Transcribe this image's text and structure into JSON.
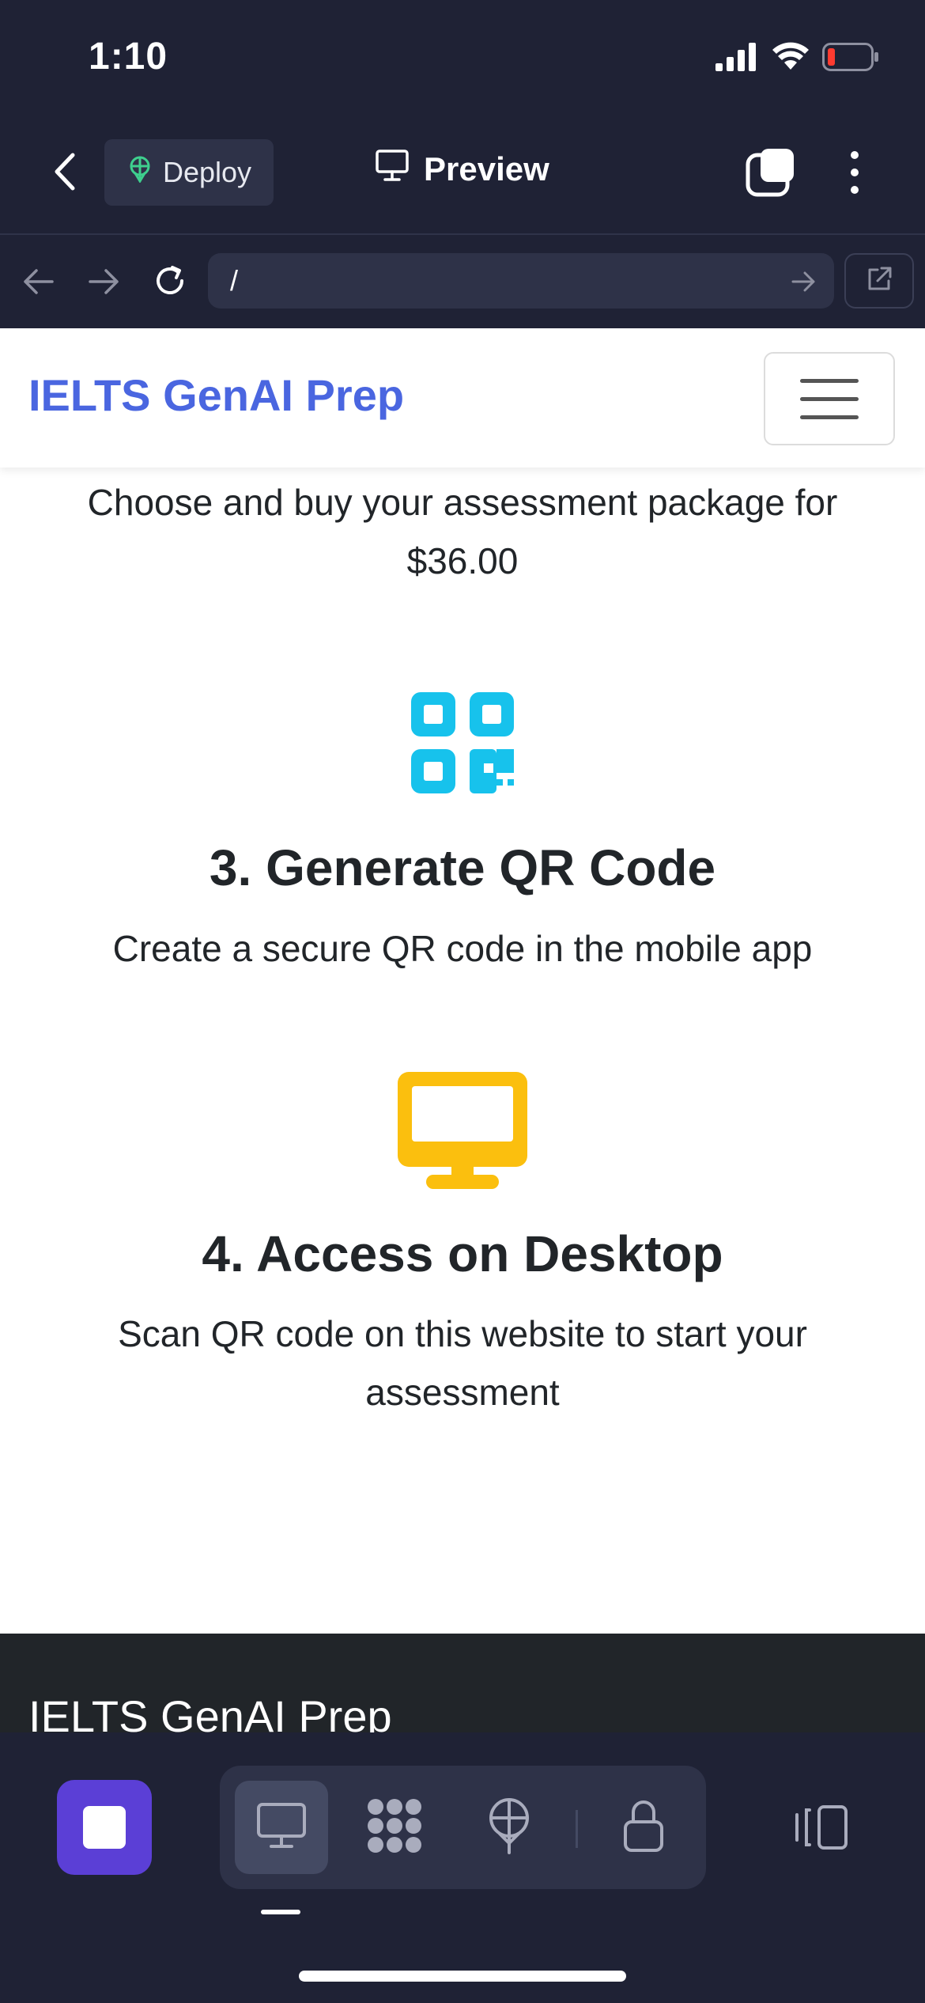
{
  "status_bar": {
    "time": "1:10"
  },
  "app_bar": {
    "deploy_label": "Deploy",
    "preview_label": "Preview"
  },
  "browser": {
    "url_value": "/"
  },
  "site": {
    "brand": "IELTS GenAI Prep",
    "step2_desc": "Choose and buy your assessment package for $36.00",
    "step3": {
      "title": "3. Generate QR Code",
      "desc": "Create a secure QR code in the mobile app",
      "icon": "qrcode-icon",
      "icon_color": "#17c2ec"
    },
    "step4": {
      "title": "4. Access on Desktop",
      "desc": "Scan QR code on this website to start your assessment",
      "icon": "desktop-icon",
      "icon_color": "#fbbf0e"
    },
    "footer_brand": "IELTS GenAI Prep",
    "brand_color": "#4a66e0"
  },
  "toolbar": {
    "accent": "#5b3fd6",
    "tools": [
      "desktop-icon",
      "apps-grid-icon",
      "deploy-icon",
      "lock-icon"
    ]
  }
}
